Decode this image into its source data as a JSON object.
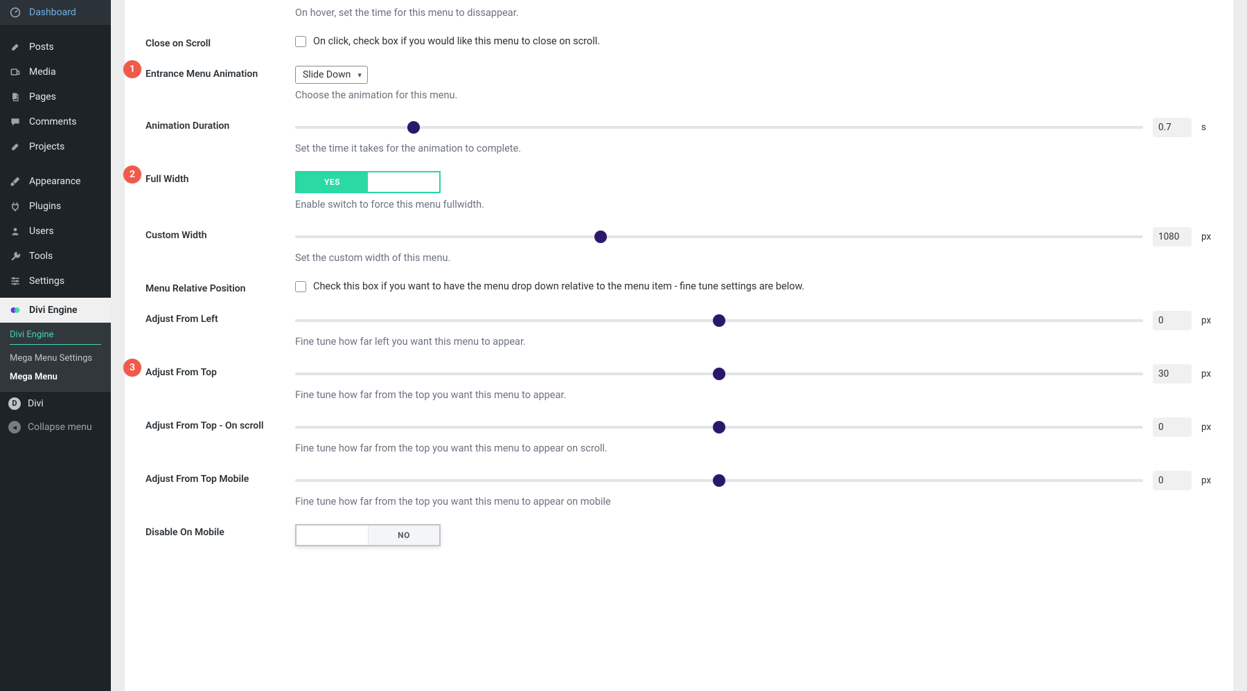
{
  "sidebar": {
    "items": [
      {
        "label": "Dashboard",
        "icon": "dashboard"
      },
      {
        "label": "Posts",
        "icon": "pin"
      },
      {
        "label": "Media",
        "icon": "media"
      },
      {
        "label": "Pages",
        "icon": "pages"
      },
      {
        "label": "Comments",
        "icon": "comment"
      },
      {
        "label": "Projects",
        "icon": "pin"
      },
      {
        "label": "Appearance",
        "icon": "brush"
      },
      {
        "label": "Plugins",
        "icon": "plug"
      },
      {
        "label": "Users",
        "icon": "user"
      },
      {
        "label": "Tools",
        "icon": "wrench"
      },
      {
        "label": "Settings",
        "icon": "sliders"
      }
    ],
    "active": {
      "label": "Divi Engine",
      "submenu": [
        {
          "label": "Divi Engine",
          "style": "teal-hr"
        },
        {
          "label": "Mega Menu Settings",
          "style": ""
        },
        {
          "label": "Mega Menu",
          "style": "bold"
        }
      ]
    },
    "divi": {
      "label": "Divi"
    },
    "collapse": {
      "label": "Collapse menu"
    }
  },
  "badges": {
    "one": "1",
    "two": "2",
    "three": "3"
  },
  "fields": {
    "hover_disappear": {
      "desc": "On hover, set the time for this menu to dissappear."
    },
    "close_on_scroll": {
      "label": "Close on Scroll",
      "text": "On click, check box if you would like this menu to close on scroll."
    },
    "entrance_anim": {
      "label": "Entrance Menu Animation",
      "value": "Slide Down",
      "desc": "Choose the animation for this menu."
    },
    "anim_duration": {
      "label": "Animation Duration",
      "value": "0.7",
      "unit": "s",
      "pct": 14,
      "desc": "Set the time it takes for the animation to complete."
    },
    "full_width": {
      "label": "Full Width",
      "on": "YES",
      "desc": "Enable switch to force this menu fullwidth."
    },
    "custom_width": {
      "label": "Custom Width",
      "value": "1080",
      "unit": "px",
      "pct": 36,
      "desc": "Set the custom width of this menu."
    },
    "relative_pos": {
      "label": "Menu Relative Position",
      "text": "Check this box if you want to have the menu drop down relative to the menu item - fine tune settings are below."
    },
    "adj_left": {
      "label": "Adjust From Left",
      "value": "0",
      "unit": "px",
      "pct": 50,
      "desc": "Fine tune how far left you want this menu to appear."
    },
    "adj_top": {
      "label": "Adjust From Top",
      "value": "30",
      "unit": "px",
      "pct": 50,
      "desc": "Fine tune how far from the top you want this menu to appear."
    },
    "adj_top_scroll": {
      "label": "Adjust From Top - On scroll",
      "value": "0",
      "unit": "px",
      "pct": 50,
      "desc": "Fine tune how far from the top you want this menu to appear on scroll."
    },
    "adj_top_mobile": {
      "label": "Adjust From Top Mobile",
      "value": "0",
      "unit": "px",
      "pct": 50,
      "desc": "Fine tune how far from the top you want this menu to appear on mobile"
    },
    "disable_mobile": {
      "label": "Disable On Mobile",
      "off": "NO"
    }
  }
}
